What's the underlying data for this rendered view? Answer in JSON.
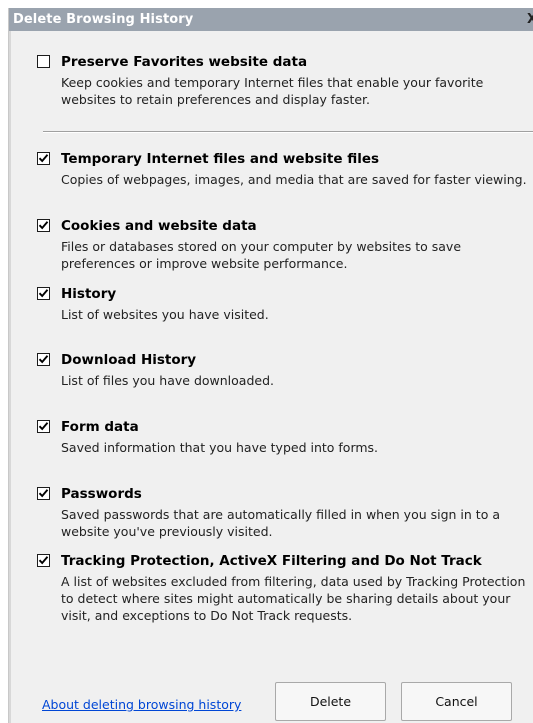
{
  "window": {
    "title": "Delete Browsing History",
    "close_glyph": "X"
  },
  "options": [
    {
      "label": "Preserve Favorites website data",
      "checked": false,
      "description": "Keep cookies and temporary Internet files that enable your favorite websites to retain preferences and display faster."
    },
    {
      "label": "Temporary Internet files and website files",
      "checked": true,
      "description": "Copies of webpages, images, and media that are saved for faster viewing."
    },
    {
      "label": "Cookies and website data",
      "checked": true,
      "description": "Files or databases stored on your computer by websites to save preferences or improve website performance."
    },
    {
      "label": "History",
      "checked": true,
      "description": "List of websites you have visited."
    },
    {
      "label": "Download History",
      "checked": true,
      "description": "List of files you have downloaded."
    },
    {
      "label": "Form data",
      "checked": true,
      "description": "Saved information that you have typed into forms."
    },
    {
      "label": "Passwords",
      "checked": true,
      "description": "Saved passwords that are automatically filled in when you sign in to a website you've previously visited."
    },
    {
      "label": "Tracking Protection, ActiveX Filtering and Do Not Track",
      "checked": true,
      "description": "A list of websites excluded from filtering, data used by Tracking Protection to detect where sites might automatically be sharing details about your visit, and exceptions to Do Not Track requests."
    }
  ],
  "footer": {
    "help_link": "About deleting browsing history",
    "delete_label": "Delete",
    "cancel_label": "Cancel"
  },
  "colors": {
    "titlebar": "#9aa3ae",
    "link": "#0046d5",
    "dialog_bg": "#f0f0f0"
  },
  "icons": {
    "checkbox_mark": "check-icon"
  }
}
